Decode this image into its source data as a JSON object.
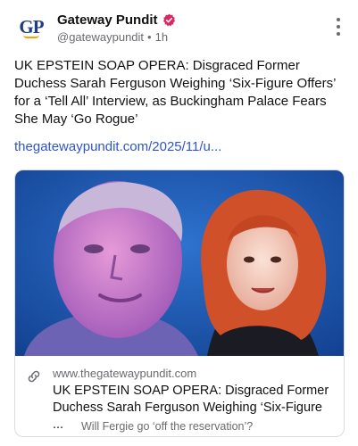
{
  "post": {
    "author_name": "Gateway Pundit",
    "handle": "@gatewaypundit",
    "separator": "•",
    "time": "1h",
    "avatar_text": "GP",
    "text": "UK EPSTEIN SOAP OPERA: Disgraced Former Duchess Sarah Ferguson Weighing ‘Six-Figure Offers’ for a ‘Tell All’ Interview, as Buckingham Palace Fears She May ‘Go Rogue’",
    "link_text": "thegatewaypundit.com/2025/11/u..."
  },
  "card": {
    "domain": "www.thegatewaypundit.com",
    "title": "UK EPSTEIN SOAP OPERA: Disgraced Former Duchess Sarah Ferguson Weighing ‘Six-Figure ...",
    "description": "Will Fergie go ‘off the reservation’?"
  },
  "icons": {
    "verified": "verified-badge-icon",
    "menu": "more-vertical-icon",
    "link": "link-icon"
  },
  "colors": {
    "link": "#2f55c8",
    "verified": "#e0245e",
    "image_bg": "#1f5fb8"
  }
}
